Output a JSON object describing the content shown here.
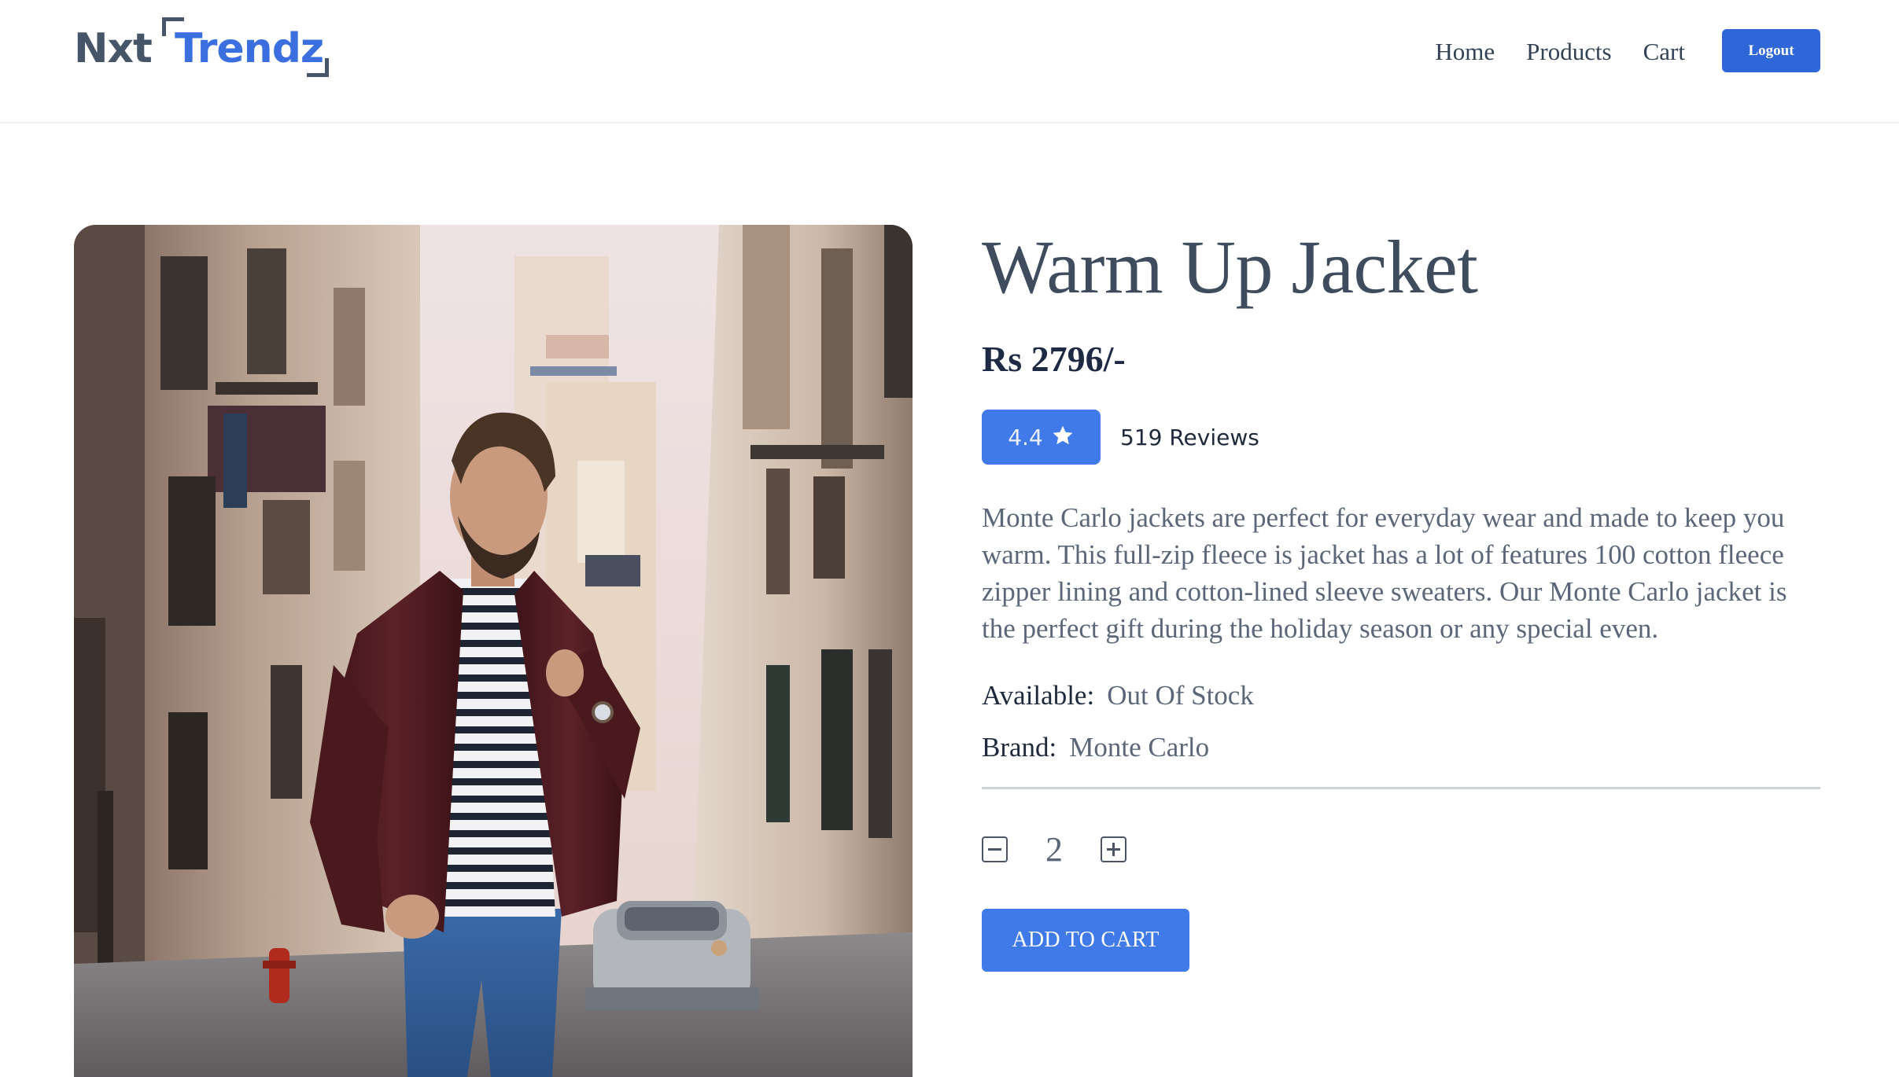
{
  "header": {
    "logo": {
      "part1": "Nxt",
      "part2": "Trendz"
    },
    "nav": [
      "Home",
      "Products",
      "Cart"
    ],
    "logout_label": "Logout"
  },
  "product": {
    "image_alt": "Man in maroon jacket walking down street",
    "title": "Warm Up Jacket",
    "price": "Rs 2796/-",
    "rating": "4.4",
    "reviews": "519 Reviews",
    "description": "Monte Carlo jackets are perfect for everyday wear and made to keep you warm. This full-zip fleece is jacket has a lot of features 100 cotton fleece zipper lining and cotton-lined sleeve sweaters. Our Monte Carlo jacket is the perfect gift during the holiday season or any special even.",
    "availability_label": "Available:",
    "availability": "Out Of Stock",
    "brand_label": "Brand:",
    "brand": "Monte Carlo",
    "quantity": "2",
    "add_to_cart_label": "ADD TO CART"
  },
  "icons": {
    "star": "star-icon",
    "minus": "minus-square-icon",
    "plus": "plus-square-icon"
  },
  "colors": {
    "accent": "#3f7ae8",
    "logout": "#2f66d8",
    "title": "#3e4c5e"
  }
}
